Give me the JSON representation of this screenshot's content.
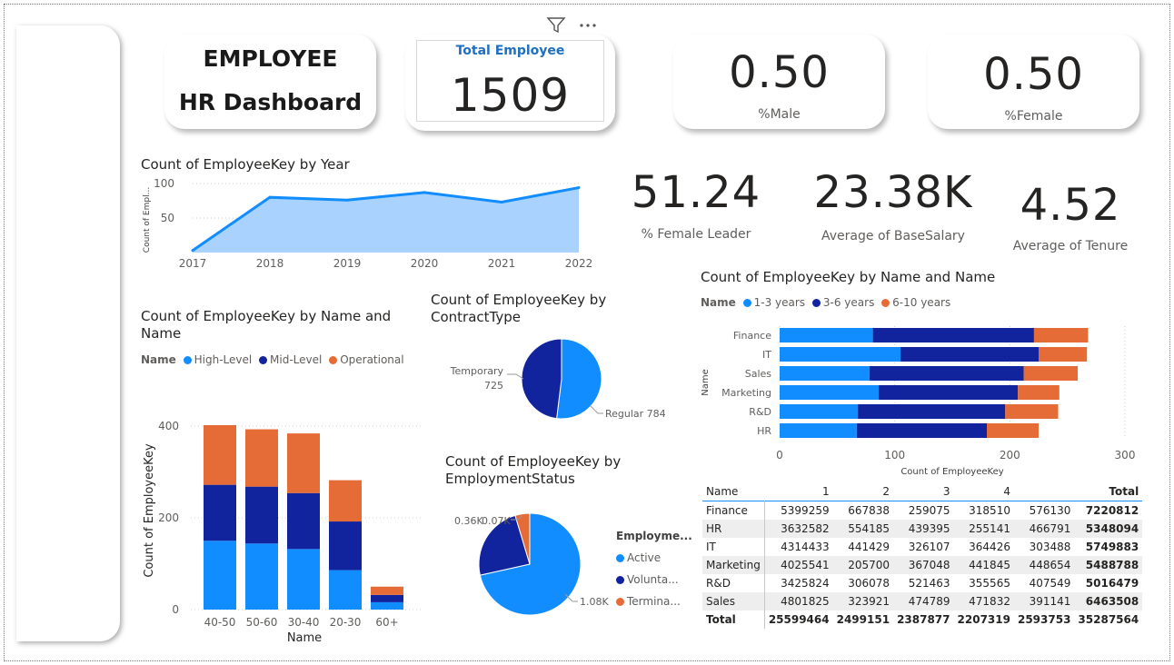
{
  "header": {
    "title_line1": "EMPLOYEE",
    "title_line2": "HR Dashboard"
  },
  "kpis": {
    "total_employee_label": "Total Employee",
    "total_employee_value": "1509",
    "male_value": "0.50",
    "male_label": "%Male",
    "female_value": "0.50",
    "female_label": "%Female",
    "female_leader_value": "51.24",
    "female_leader_label": "% Female Leader",
    "avg_salary_value": "23.38K",
    "avg_salary_label": "Average of BaseSalary",
    "avg_tenure_value": "4.52",
    "avg_tenure_label": "Average of Tenure"
  },
  "visual_header": {
    "filter_icon": "filter-icon",
    "more_icon": "more-options-icon"
  },
  "colors": {
    "light_blue": "#118dff",
    "dark_blue": "#12239e",
    "orange": "#e66c37",
    "area_fill": "#a9d3fe"
  },
  "year_chart": {
    "title": "Count of EmployeeKey by Year",
    "ylabel": "Count of Empl...",
    "yticks": [
      "100",
      "50"
    ],
    "chart_data": {
      "type": "area",
      "x": [
        "2017",
        "2018",
        "2019",
        "2020",
        "2021",
        "2022"
      ],
      "values": [
        3,
        80,
        76,
        87,
        73,
        94
      ],
      "ylim": [
        0,
        100
      ],
      "ylabel": "Count of Empl...",
      "grid": true
    }
  },
  "age_chart": {
    "title": "Count of EmployeeKey by Name and Name",
    "legend_title": "Name",
    "xlabel": "Name",
    "ylabel": "Count of EmployeeKey",
    "yticks": [
      "400",
      "200",
      "0"
    ],
    "chart_data": {
      "type": "bar",
      "stacked": true,
      "categories": [
        "40-50",
        "50-60",
        "30-40",
        "20-30",
        "60+"
      ],
      "series": [
        {
          "name": "High-Level",
          "values": [
            150,
            144,
            132,
            86,
            16
          ]
        },
        {
          "name": "Mid-Level",
          "values": [
            122,
            124,
            122,
            106,
            16
          ]
        },
        {
          "name": "Operational",
          "values": [
            130,
            125,
            130,
            90,
            18
          ]
        }
      ],
      "ylim": [
        0,
        420
      ]
    }
  },
  "contract_chart": {
    "title": "Count of EmployeeKey by ContractType",
    "label_temporary_1": "Temporary",
    "label_temporary_2": "725",
    "label_regular": "Regular 784",
    "chart_data": {
      "type": "pie",
      "categories": [
        "Regular",
        "Temporary"
      ],
      "values": [
        784,
        725
      ]
    }
  },
  "status_chart": {
    "title": "Count of EmployeeKey by EmploymentStatus",
    "legend_title": "Employme...",
    "legend": [
      "Active",
      "Volunta...",
      "Termina..."
    ],
    "label_active": "1.08K",
    "label_voluntary": "0.36K",
    "label_terminated": "0.07K",
    "chart_data": {
      "type": "pie",
      "categories": [
        "Active",
        "Voluntarily Terminated",
        "Terminated for Cause"
      ],
      "values": [
        1080,
        360,
        70
      ]
    }
  },
  "tenure_chart": {
    "title": "Count of EmployeeKey by Name and Name",
    "legend_title": "Name",
    "xlabel": "Count of EmployeeKey",
    "ylabel": "Name",
    "xticks": [
      "0",
      "100",
      "200",
      "300"
    ],
    "chart_data": {
      "type": "bar",
      "orientation": "horizontal",
      "stacked": true,
      "categories": [
        "Finance",
        "IT",
        "Sales",
        "Marketing",
        "R&D",
        "HR"
      ],
      "series": [
        {
          "name": "1-3 years",
          "values": [
            81,
            105,
            78,
            86,
            68,
            67
          ]
        },
        {
          "name": "3-6 years",
          "values": [
            140,
            120,
            134,
            121,
            128,
            113
          ]
        },
        {
          "name": "6-10 years",
          "values": [
            47,
            42,
            47,
            36,
            46,
            45
          ]
        }
      ],
      "xlim": [
        0,
        300
      ]
    }
  },
  "salary_table": {
    "columns": [
      "Name",
      "1",
      "2",
      "3",
      "4",
      "",
      "Total"
    ],
    "rows": [
      [
        "Finance",
        "5399259",
        "667838",
        "259075",
        "318510",
        "576130",
        "7220812"
      ],
      [
        "HR",
        "3632582",
        "554185",
        "439395",
        "255141",
        "466791",
        "5348094"
      ],
      [
        "IT",
        "4314433",
        "441429",
        "326107",
        "364426",
        "303488",
        "5749883"
      ],
      [
        "Marketing",
        "4025541",
        "205700",
        "367048",
        "441845",
        "448654",
        "5488788"
      ],
      [
        "R&D",
        "3425824",
        "306078",
        "521463",
        "355565",
        "407549",
        "5016479"
      ],
      [
        "Sales",
        "4801825",
        "323921",
        "474789",
        "471832",
        "391141",
        "6463508"
      ]
    ],
    "total": [
      "Total",
      "25599464",
      "2499151",
      "2387877",
      "2207319",
      "2593753",
      "35287564"
    ]
  }
}
